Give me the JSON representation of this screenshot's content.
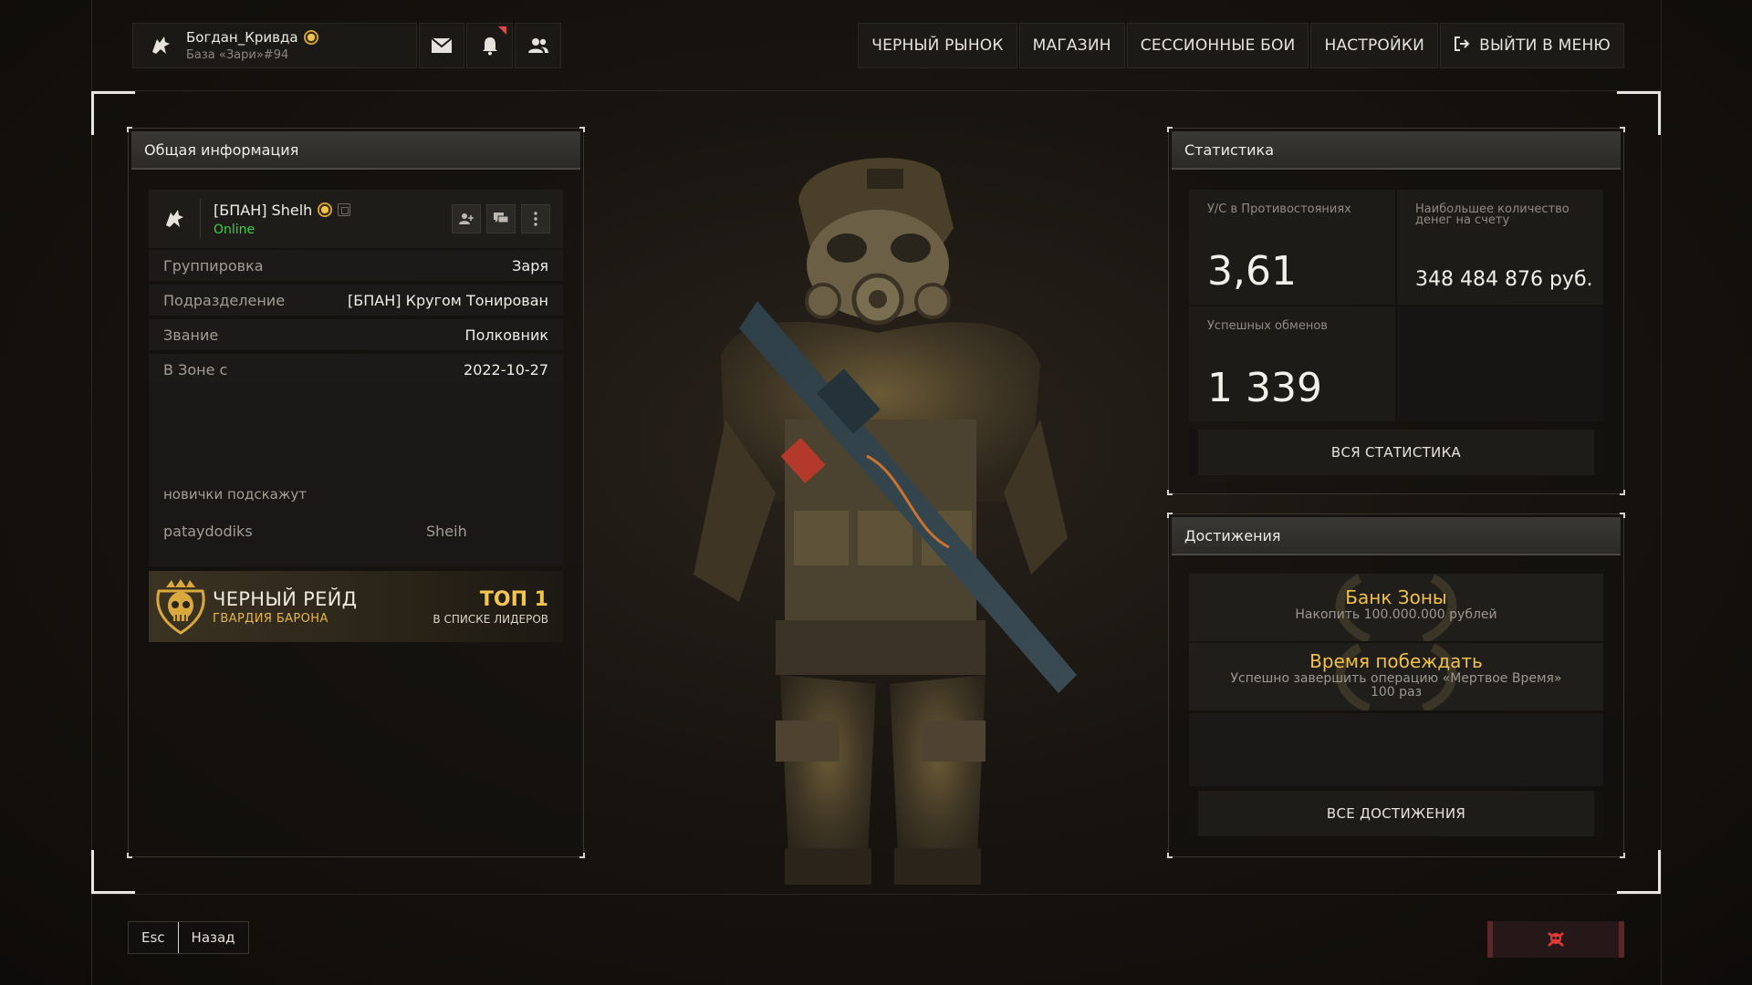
{
  "profile": {
    "name": "Богдан_Кривда",
    "base": "База «Зари»#94"
  },
  "nav": {
    "items": [
      "ЧЕРНЫЙ РЫНОК",
      "МАГАЗИН",
      "СЕССИОННЫЕ БОИ",
      "НАСТРОЙКИ"
    ],
    "exit_label": "ВЫЙТИ В МЕНЮ"
  },
  "info": {
    "title": "Общая информация",
    "player_name": "[БПАН] Shelh",
    "status": "Online",
    "rows": [
      {
        "label": "Группировка",
        "value": "Заря"
      },
      {
        "label": "Подразделение",
        "value": "[БПАН] Кругом Тонирован"
      },
      {
        "label": "Звание",
        "value": "Полковник"
      },
      {
        "label": "В Зоне с",
        "value": "2022-10-27"
      }
    ],
    "note_title": "новички подскажут",
    "note_left": "pataydodiks",
    "note_right": "Sheih",
    "raid": {
      "title": "ЧЕРНЫЙ РЕЙД",
      "subtitle": "ГВАРДИЯ БАРОНА",
      "rank": "ТОП 1",
      "rank_sub": "В СПИСКЕ ЛИДЕРОВ"
    }
  },
  "stats": {
    "title": "Статистика",
    "kd_label": "У/С в Противостояниях",
    "kd_value": "3,61",
    "money_label_1": "Наибольшее количество",
    "money_label_2": "денег на счету",
    "money_value": "348 484 876 руб.",
    "trades_label": "Успешных обменов",
    "trades_value": "1 339",
    "all_button": "ВСЯ СТАТИСТИКА"
  },
  "achievements": {
    "title": "Достижения",
    "items": [
      {
        "title": "Банк Зоны",
        "desc": "Накопить 100.000.000 рублей",
        "desc2": ""
      },
      {
        "title": "Время побеждать",
        "desc": "Успешно завершить операцию «Мертвое Время»",
        "desc2": "100 раз"
      }
    ],
    "all_button": "ВСЕ ДОСТИЖЕНИЯ"
  },
  "bottom": {
    "esc": "Esc",
    "back": "Назад"
  },
  "colors": {
    "accent_gold": "#f0c14a",
    "online_green": "#3ad33f",
    "notify_red": "#e2484a",
    "danger_red": "#e03a3a"
  }
}
